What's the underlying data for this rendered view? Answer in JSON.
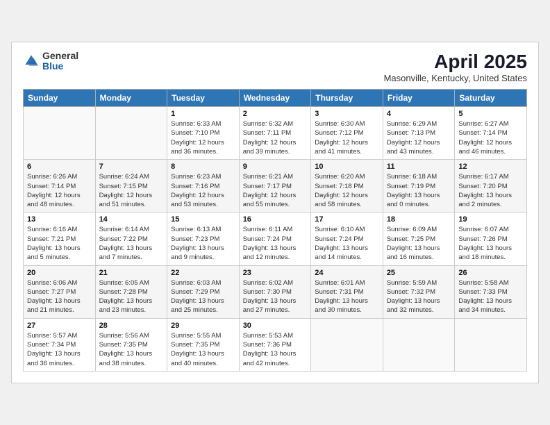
{
  "header": {
    "logo_general": "General",
    "logo_blue": "Blue",
    "month": "April 2025",
    "location": "Masonville, Kentucky, United States"
  },
  "days_of_week": [
    "Sunday",
    "Monday",
    "Tuesday",
    "Wednesday",
    "Thursday",
    "Friday",
    "Saturday"
  ],
  "weeks": [
    [
      {
        "day": "",
        "info": ""
      },
      {
        "day": "",
        "info": ""
      },
      {
        "day": "1",
        "sunrise": "Sunrise: 6:33 AM",
        "sunset": "Sunset: 7:10 PM",
        "daylight": "Daylight: 12 hours and 36 minutes."
      },
      {
        "day": "2",
        "sunrise": "Sunrise: 6:32 AM",
        "sunset": "Sunset: 7:11 PM",
        "daylight": "Daylight: 12 hours and 39 minutes."
      },
      {
        "day": "3",
        "sunrise": "Sunrise: 6:30 AM",
        "sunset": "Sunset: 7:12 PM",
        "daylight": "Daylight: 12 hours and 41 minutes."
      },
      {
        "day": "4",
        "sunrise": "Sunrise: 6:29 AM",
        "sunset": "Sunset: 7:13 PM",
        "daylight": "Daylight: 12 hours and 43 minutes."
      },
      {
        "day": "5",
        "sunrise": "Sunrise: 6:27 AM",
        "sunset": "Sunset: 7:14 PM",
        "daylight": "Daylight: 12 hours and 46 minutes."
      }
    ],
    [
      {
        "day": "6",
        "sunrise": "Sunrise: 6:26 AM",
        "sunset": "Sunset: 7:14 PM",
        "daylight": "Daylight: 12 hours and 48 minutes."
      },
      {
        "day": "7",
        "sunrise": "Sunrise: 6:24 AM",
        "sunset": "Sunset: 7:15 PM",
        "daylight": "Daylight: 12 hours and 51 minutes."
      },
      {
        "day": "8",
        "sunrise": "Sunrise: 6:23 AM",
        "sunset": "Sunset: 7:16 PM",
        "daylight": "Daylight: 12 hours and 53 minutes."
      },
      {
        "day": "9",
        "sunrise": "Sunrise: 6:21 AM",
        "sunset": "Sunset: 7:17 PM",
        "daylight": "Daylight: 12 hours and 55 minutes."
      },
      {
        "day": "10",
        "sunrise": "Sunrise: 6:20 AM",
        "sunset": "Sunset: 7:18 PM",
        "daylight": "Daylight: 12 hours and 58 minutes."
      },
      {
        "day": "11",
        "sunrise": "Sunrise: 6:18 AM",
        "sunset": "Sunset: 7:19 PM",
        "daylight": "Daylight: 13 hours and 0 minutes."
      },
      {
        "day": "12",
        "sunrise": "Sunrise: 6:17 AM",
        "sunset": "Sunset: 7:20 PM",
        "daylight": "Daylight: 13 hours and 2 minutes."
      }
    ],
    [
      {
        "day": "13",
        "sunrise": "Sunrise: 6:16 AM",
        "sunset": "Sunset: 7:21 PM",
        "daylight": "Daylight: 13 hours and 5 minutes."
      },
      {
        "day": "14",
        "sunrise": "Sunrise: 6:14 AM",
        "sunset": "Sunset: 7:22 PM",
        "daylight": "Daylight: 13 hours and 7 minutes."
      },
      {
        "day": "15",
        "sunrise": "Sunrise: 6:13 AM",
        "sunset": "Sunset: 7:23 PM",
        "daylight": "Daylight: 13 hours and 9 minutes."
      },
      {
        "day": "16",
        "sunrise": "Sunrise: 6:11 AM",
        "sunset": "Sunset: 7:24 PM",
        "daylight": "Daylight: 13 hours and 12 minutes."
      },
      {
        "day": "17",
        "sunrise": "Sunrise: 6:10 AM",
        "sunset": "Sunset: 7:24 PM",
        "daylight": "Daylight: 13 hours and 14 minutes."
      },
      {
        "day": "18",
        "sunrise": "Sunrise: 6:09 AM",
        "sunset": "Sunset: 7:25 PM",
        "daylight": "Daylight: 13 hours and 16 minutes."
      },
      {
        "day": "19",
        "sunrise": "Sunrise: 6:07 AM",
        "sunset": "Sunset: 7:26 PM",
        "daylight": "Daylight: 13 hours and 18 minutes."
      }
    ],
    [
      {
        "day": "20",
        "sunrise": "Sunrise: 6:06 AM",
        "sunset": "Sunset: 7:27 PM",
        "daylight": "Daylight: 13 hours and 21 minutes."
      },
      {
        "day": "21",
        "sunrise": "Sunrise: 6:05 AM",
        "sunset": "Sunset: 7:28 PM",
        "daylight": "Daylight: 13 hours and 23 minutes."
      },
      {
        "day": "22",
        "sunrise": "Sunrise: 6:03 AM",
        "sunset": "Sunset: 7:29 PM",
        "daylight": "Daylight: 13 hours and 25 minutes."
      },
      {
        "day": "23",
        "sunrise": "Sunrise: 6:02 AM",
        "sunset": "Sunset: 7:30 PM",
        "daylight": "Daylight: 13 hours and 27 minutes."
      },
      {
        "day": "24",
        "sunrise": "Sunrise: 6:01 AM",
        "sunset": "Sunset: 7:31 PM",
        "daylight": "Daylight: 13 hours and 30 minutes."
      },
      {
        "day": "25",
        "sunrise": "Sunrise: 5:59 AM",
        "sunset": "Sunset: 7:32 PM",
        "daylight": "Daylight: 13 hours and 32 minutes."
      },
      {
        "day": "26",
        "sunrise": "Sunrise: 5:58 AM",
        "sunset": "Sunset: 7:33 PM",
        "daylight": "Daylight: 13 hours and 34 minutes."
      }
    ],
    [
      {
        "day": "27",
        "sunrise": "Sunrise: 5:57 AM",
        "sunset": "Sunset: 7:34 PM",
        "daylight": "Daylight: 13 hours and 36 minutes."
      },
      {
        "day": "28",
        "sunrise": "Sunrise: 5:56 AM",
        "sunset": "Sunset: 7:35 PM",
        "daylight": "Daylight: 13 hours and 38 minutes."
      },
      {
        "day": "29",
        "sunrise": "Sunrise: 5:55 AM",
        "sunset": "Sunset: 7:35 PM",
        "daylight": "Daylight: 13 hours and 40 minutes."
      },
      {
        "day": "30",
        "sunrise": "Sunrise: 5:53 AM",
        "sunset": "Sunset: 7:36 PM",
        "daylight": "Daylight: 13 hours and 42 minutes."
      },
      {
        "day": "",
        "info": ""
      },
      {
        "day": "",
        "info": ""
      },
      {
        "day": "",
        "info": ""
      }
    ]
  ]
}
